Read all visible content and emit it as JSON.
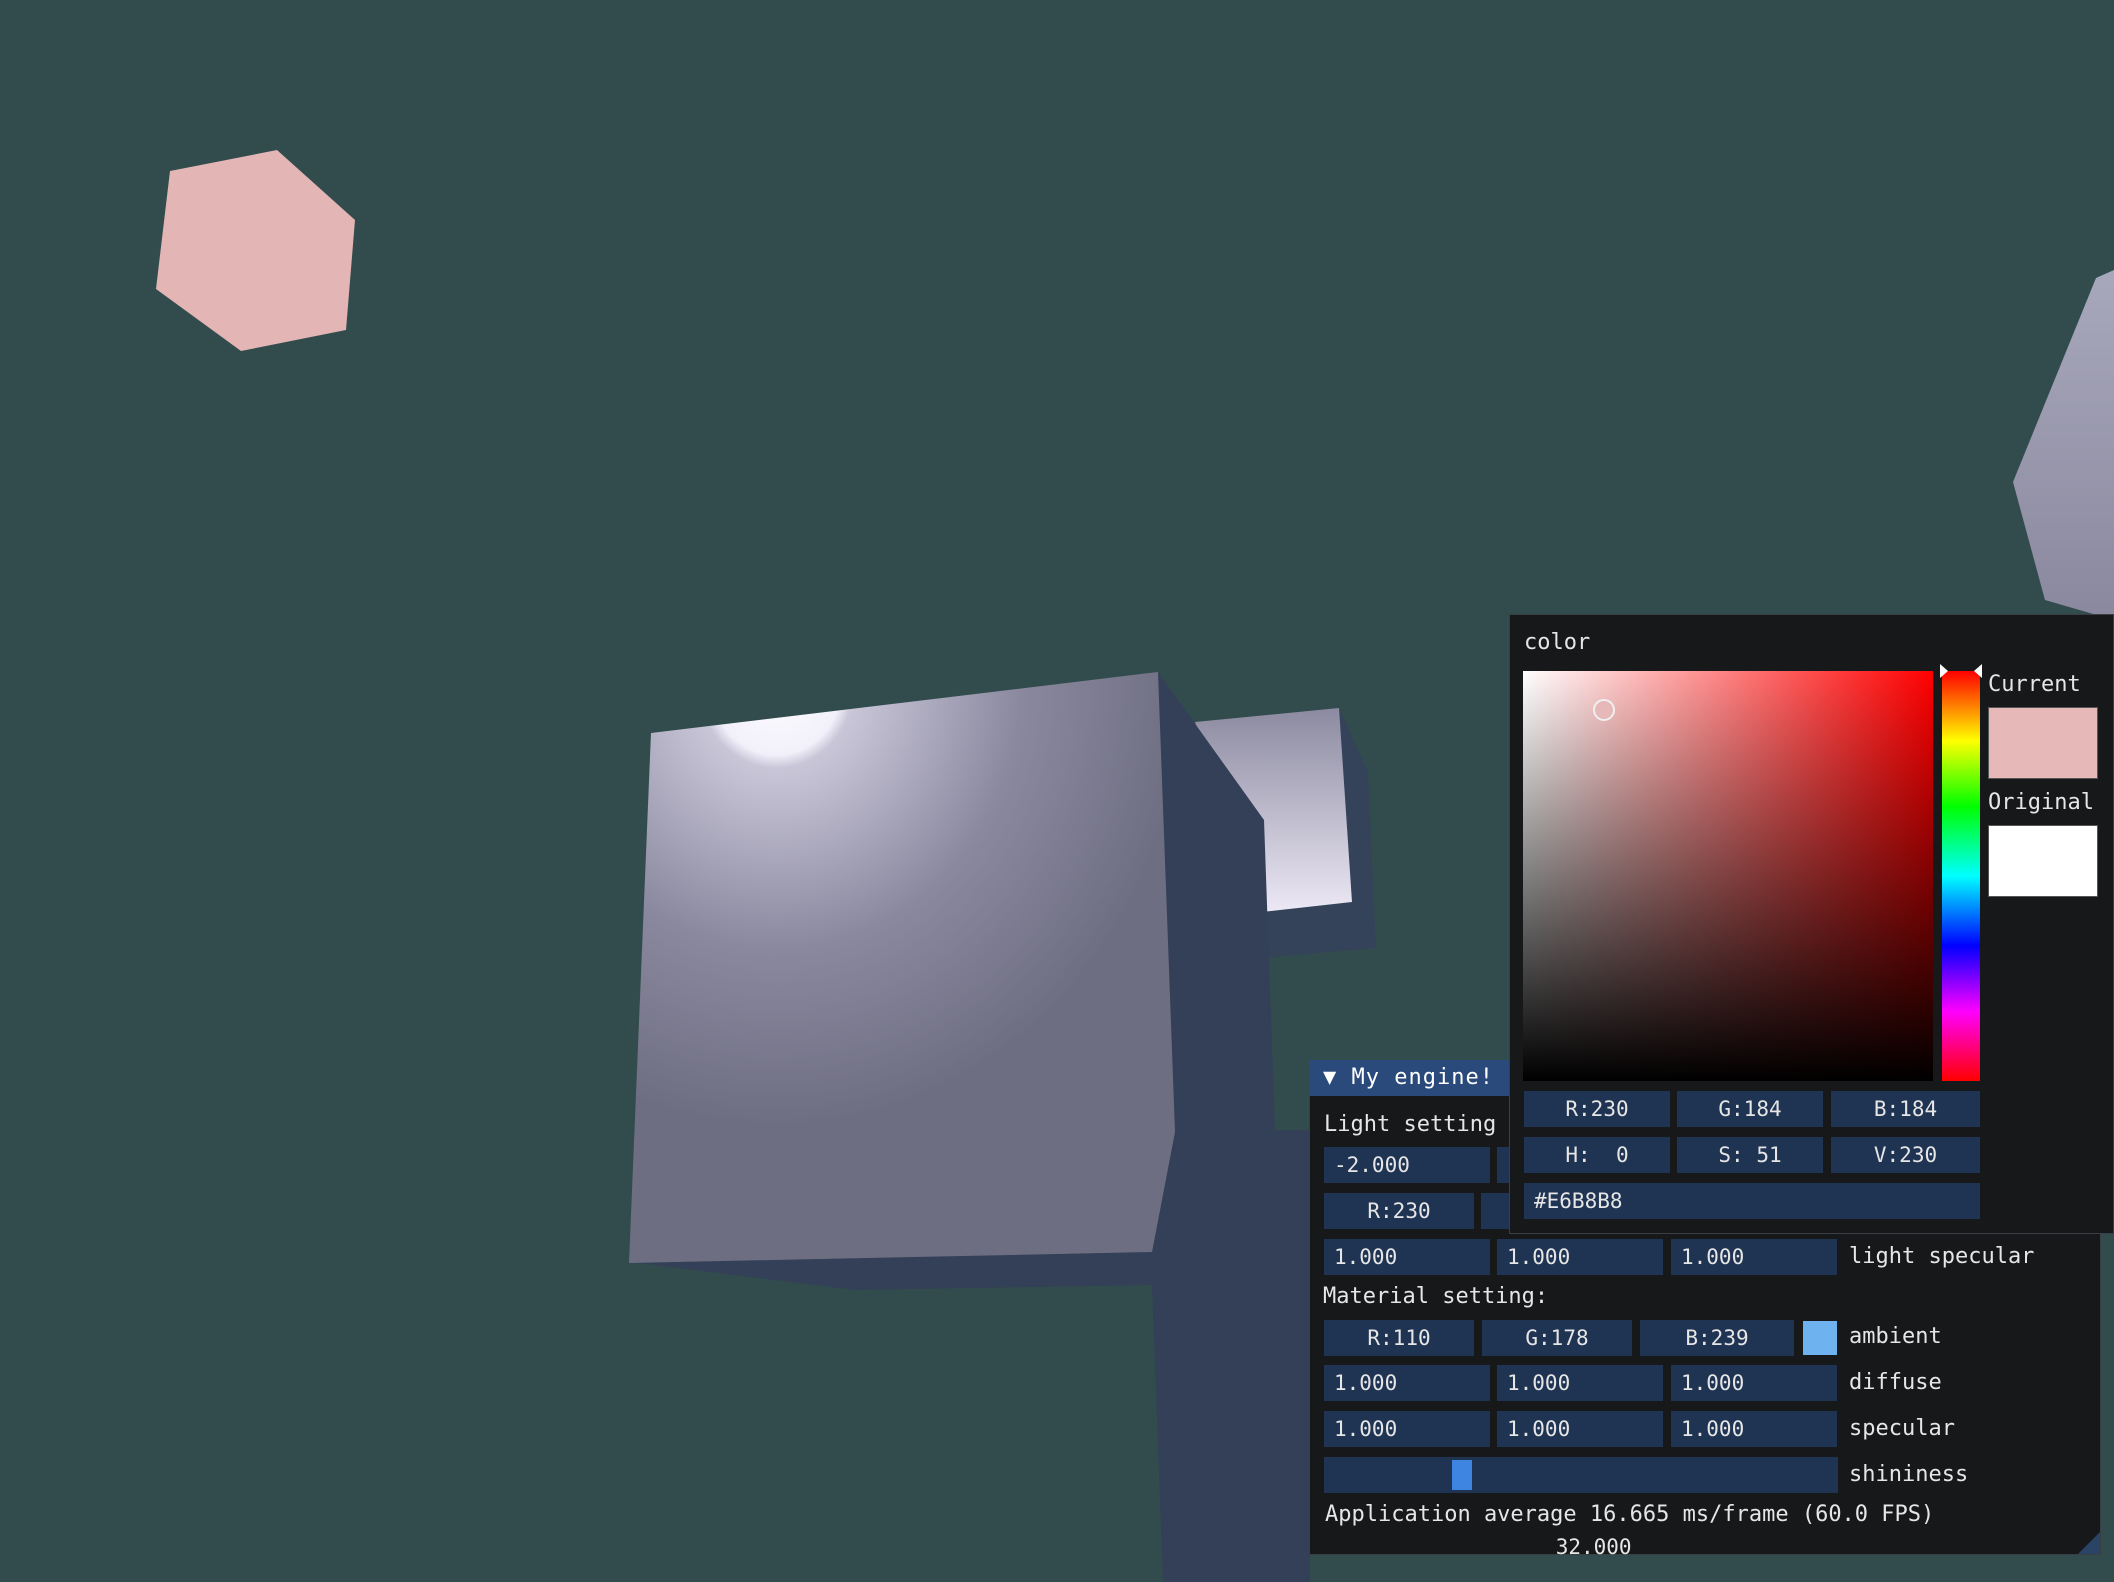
{
  "window": {
    "title": "My engine!",
    "light_label": "Light setting",
    "light_position": [
      "-2.000"
    ],
    "light_ambient": [
      "R:230"
    ],
    "light_specular": [
      "1.000",
      "1.000",
      "1.000"
    ],
    "light_specular_label": "light specular",
    "material_label": "Material setting:",
    "ambient": {
      "r": "R:110",
      "g": "G:178",
      "b": "B:239",
      "label": "ambient",
      "color": "#6eb2ef"
    },
    "diffuse": {
      "values": [
        "1.000",
        "1.000",
        "1.000"
      ],
      "label": "diffuse"
    },
    "specular": {
      "values": [
        "1.000",
        "1.000",
        "1.000"
      ],
      "label": "specular"
    },
    "shininess": {
      "value": "32.000",
      "label": "shininess",
      "fraction": 0.25
    },
    "status": "Application average 16.665 ms/frame (60.0 FPS)"
  },
  "color_picker": {
    "title": "color",
    "current_label": "Current",
    "original_label": "Original",
    "current_color": "#E6B8B8",
    "original_color": "#FFFFFF",
    "rgb": [
      "R:230",
      "G:184",
      "B:184"
    ],
    "hsv": [
      "H:  0",
      "S: 51",
      "V:230"
    ],
    "hex": "#E6B8B8"
  },
  "colors": {
    "background": "#324c4d",
    "field": "#1f3352",
    "titlebar": "#294a7a",
    "slider_grab": "#3d85e0",
    "light_cube": "#e6b8b8"
  }
}
